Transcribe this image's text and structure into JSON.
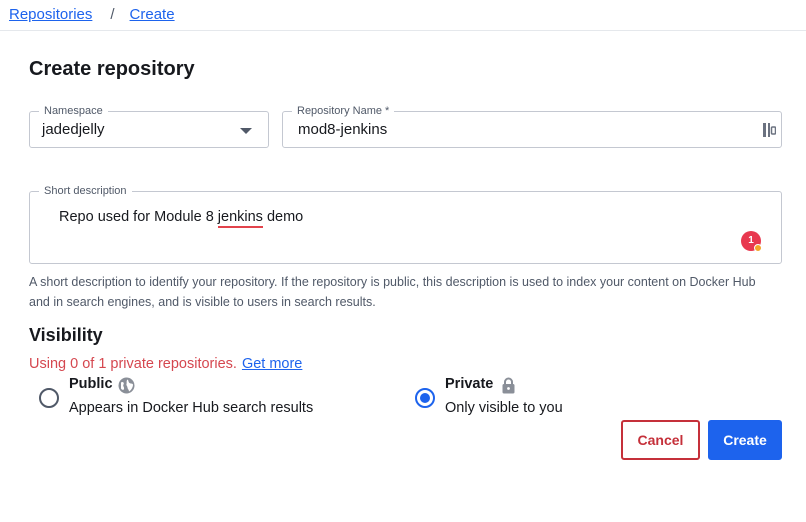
{
  "breadcrumb": {
    "items": [
      "Repositories",
      "Create"
    ],
    "separator": "/"
  },
  "page_title": "Create repository",
  "form": {
    "namespace": {
      "label": "Namespace",
      "value": "jadedjelly"
    },
    "repository_name": {
      "label": "Repository Name *",
      "value": "mod8-jenkins"
    },
    "short_description": {
      "label": "Short description",
      "value_before": "Repo used for Module 8 ",
      "value_misspelled": "jenkins",
      "value_after": " demo",
      "grammar_badge_count": "1",
      "helper": "A short description to identify your repository. If the repository is public, this description is used to index your content on Docker Hub and in search engines, and is visible to users in search results."
    }
  },
  "visibility": {
    "title": "Visibility",
    "usage_text": "Using 0 of 1 private repositories.",
    "get_more": "Get more",
    "options": [
      {
        "title": "Public",
        "description": "Appears in Docker Hub search results",
        "icon": "globe-icon",
        "selected": false
      },
      {
        "title": "Private",
        "description": "Only visible to you",
        "icon": "lock-icon",
        "selected": true
      }
    ]
  },
  "actions": {
    "cancel": "Cancel",
    "create": "Create"
  },
  "colors": {
    "accent": "#1d63ed",
    "danger": "#c5303a",
    "usage_text": "#d5474f"
  }
}
